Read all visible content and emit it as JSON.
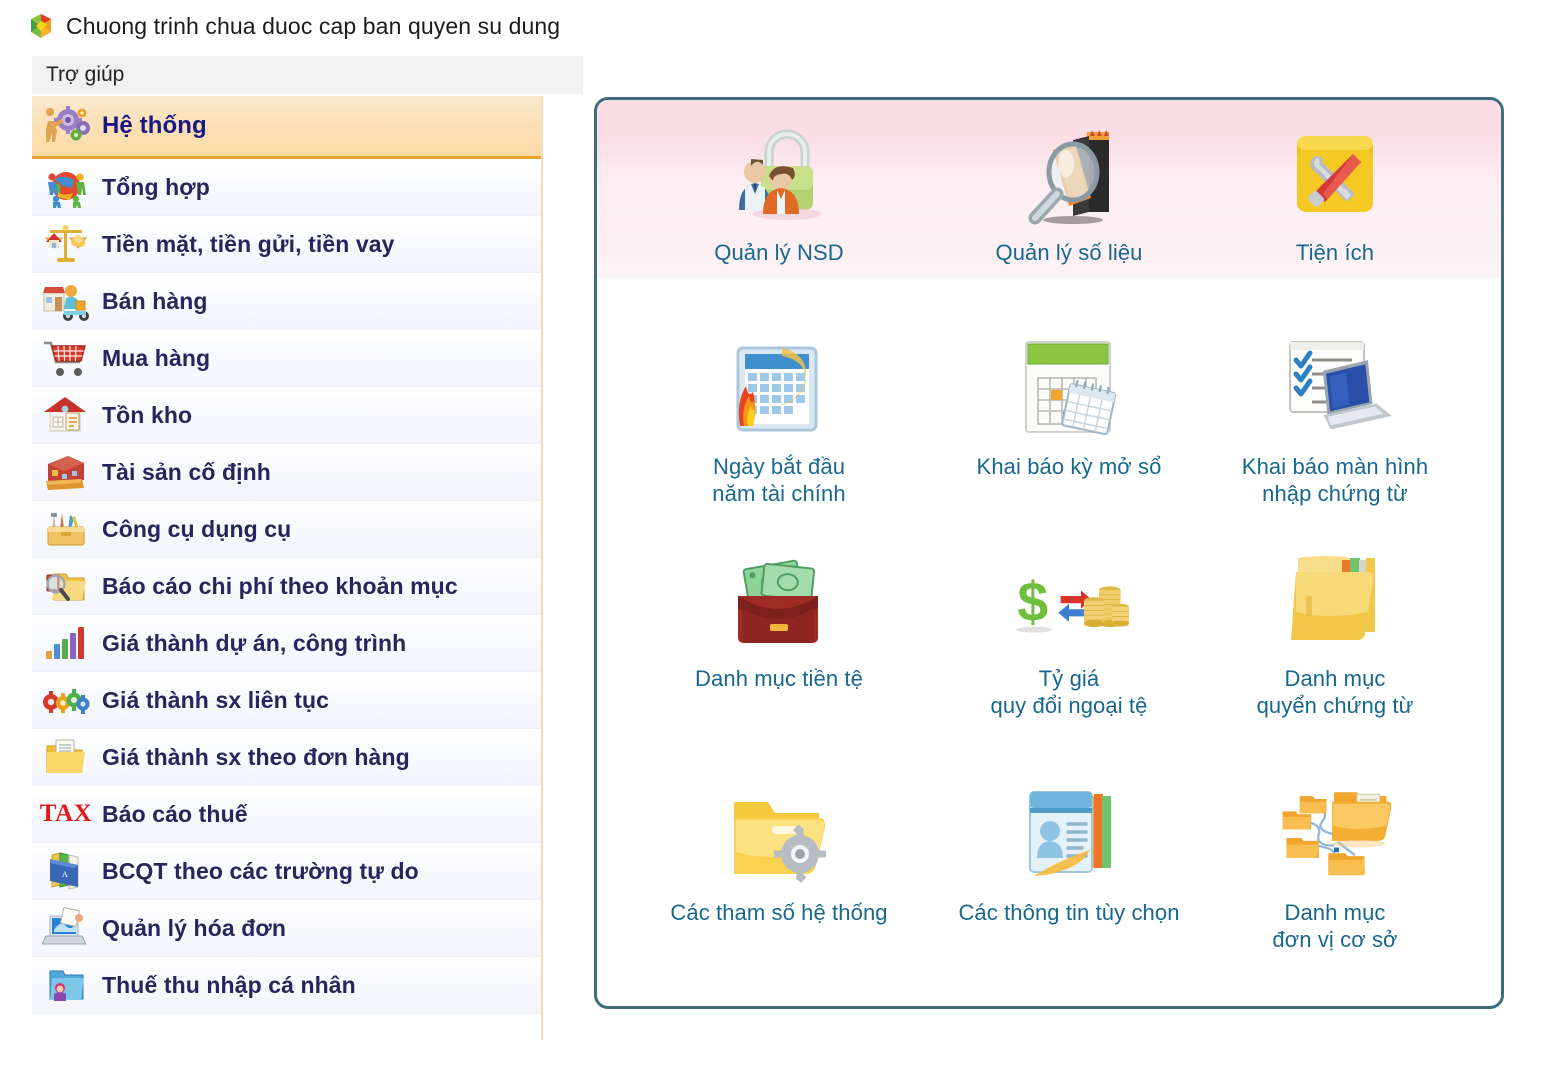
{
  "window": {
    "title": "Chuong trinh chua duoc cap ban quyen su dung",
    "logo_icon": "pinwheel-logo-icon"
  },
  "menubar": {
    "items": [
      {
        "label": "Trợ giúp",
        "name": "menu-item-tro-giup"
      }
    ]
  },
  "sidebar": {
    "items": [
      {
        "label": "Hệ thống",
        "icon": "gears-person-icon",
        "selected": true
      },
      {
        "label": "Tổng hợp",
        "icon": "globe-people-icon",
        "selected": false
      },
      {
        "label": "Tiền mặt, tiền gửi, tiền vay",
        "icon": "balance-scale-icon",
        "selected": false
      },
      {
        "label": "Bán hàng",
        "icon": "delivery-shop-icon",
        "selected": false
      },
      {
        "label": "Mua hàng",
        "icon": "shopping-cart-icon",
        "selected": false
      },
      {
        "label": "Tồn kho",
        "icon": "warehouse-house-icon",
        "selected": false
      },
      {
        "label": "Tài sản cố định",
        "icon": "red-building-icon",
        "selected": false
      },
      {
        "label": "Công cụ dụng cụ",
        "icon": "toolbox-icon",
        "selected": false
      },
      {
        "label": "Báo cáo chi phí theo khoản mục",
        "icon": "folder-magnifier-icon",
        "selected": false
      },
      {
        "label": "Giá thành dự án, công trình",
        "icon": "bar-chart-icon",
        "selected": false
      },
      {
        "label": "Giá thành sx liên tục",
        "icon": "colored-gears-icon",
        "selected": false
      },
      {
        "label": "Giá thành sx theo đơn hàng",
        "icon": "folder-document-icon",
        "selected": false
      },
      {
        "label": "Báo cáo thuế",
        "icon": "tax-text-icon",
        "selected": false
      },
      {
        "label": "BCQT theo các trường tự do",
        "icon": "binders-icon",
        "selected": false
      },
      {
        "label": "Quản lý hóa đơn",
        "icon": "laptop-invoice-icon",
        "selected": false
      },
      {
        "label": "Thuế thu nhập cá nhân",
        "icon": "blue-folder-person-icon",
        "selected": false
      }
    ]
  },
  "panel": {
    "band_color": "#fbdde6",
    "border_color": "#3f6c7c",
    "label_color": "#17678f",
    "tiles": [
      {
        "label": "Quản lý NSD",
        "icon": "padlock-users-icon",
        "row": 1,
        "col": 1
      },
      {
        "label": "Quản lý số liệu",
        "icon": "books-magnifier-icon",
        "row": 1,
        "col": 2
      },
      {
        "label": "Tiện ích",
        "icon": "yellow-toolbox-tools-icon",
        "row": 1,
        "col": 3
      },
      {
        "label": "Ngày bắt đầu\nnăm tài chính",
        "icon": "calendar-fire-icon",
        "row": 2,
        "col": 1
      },
      {
        "label": "Khai báo kỳ mở sổ",
        "icon": "calendar-grid-icon",
        "row": 2,
        "col": 2
      },
      {
        "label": "Khai báo màn hình\nnhập chứng từ",
        "icon": "checklist-laptop-icon",
        "row": 2,
        "col": 3
      },
      {
        "label": "Danh mục tiền tệ",
        "icon": "money-wallet-icon",
        "row": 3,
        "col": 1
      },
      {
        "label": "Tỷ giá\nquy đổi ngoại tệ",
        "icon": "dollar-coins-exchange-icon",
        "row": 3,
        "col": 2
      },
      {
        "label": "Danh mục\nquyển chứng từ",
        "icon": "folder-files-icon",
        "row": 3,
        "col": 3
      },
      {
        "label": "Các tham số hệ thống",
        "icon": "folder-gear-icon",
        "row": 4,
        "col": 1
      },
      {
        "label": "Các thông tin tùy chọn",
        "icon": "profile-card-icon",
        "row": 4,
        "col": 2
      },
      {
        "label": "Danh mục\nđơn vị cơ sở",
        "icon": "folder-network-icon",
        "row": 4,
        "col": 3
      }
    ]
  }
}
